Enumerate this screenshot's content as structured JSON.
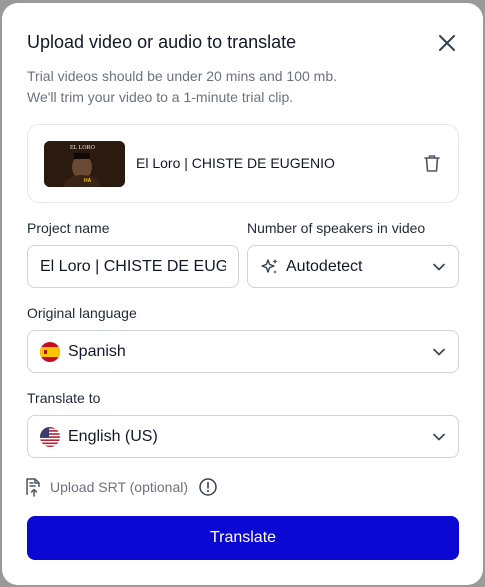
{
  "modal": {
    "title": "Upload video or audio to translate",
    "description_line1": "Trial videos should be under 20 mins and 100 mb.",
    "description_line2": "We'll trim your video to a 1-minute trial clip."
  },
  "file": {
    "name": "El Loro | CHISTE DE EUGENIO",
    "thumbnail_text_top": "EL LORO",
    "thumbnail_text_bottom": "HA"
  },
  "project": {
    "label": "Project name",
    "value": "El Loro | CHISTE DE EUGENIO"
  },
  "speakers": {
    "label": "Number of speakers in video",
    "value": "Autodetect",
    "icon": "sparkle-icon"
  },
  "original_language": {
    "label": "Original language",
    "value": "Spanish",
    "flag": "spain-flag-icon"
  },
  "translate_to": {
    "label": "Translate to",
    "value": "English (US)",
    "flag": "us-flag-icon"
  },
  "srt": {
    "label": "Upload SRT (optional)"
  },
  "actions": {
    "translate_label": "Translate"
  },
  "colors": {
    "primary": "#0a08d2",
    "border": "#d1d5db",
    "muted_text": "#6b7280"
  }
}
